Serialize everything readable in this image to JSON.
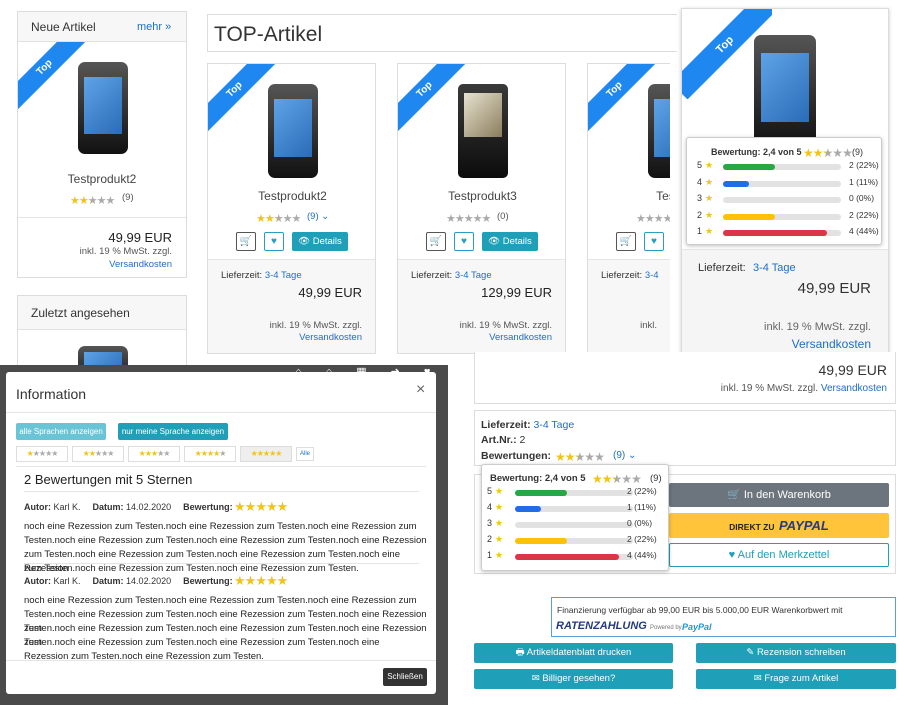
{
  "sidebar": {
    "new_title": "Neue Artikel",
    "more_link": "mehr »",
    "new_product": {
      "name": "Testprodukt2",
      "count": "(9)",
      "price": "49,99 EUR",
      "tax": "inkl. 19 % MwSt. zzgl.",
      "shipping": "Versandkosten",
      "rating": 2.4
    },
    "recent_title": "Zuletzt angesehen"
  },
  "top": {
    "title": "TOP-Artikel",
    "ribbon": "Top",
    "products": [
      {
        "name": "Testprodukt2",
        "count": "(9)",
        "delivery_label": "Lieferzeit:",
        "delivery": "3-4 Tage",
        "price": "49,99 EUR",
        "tax": "inkl. 19 % MwSt. zzgl.",
        "shipping": "Versandkosten",
        "details": "Details",
        "rating": 2.4,
        "phone": "iphone"
      },
      {
        "name": "Testprodukt3",
        "count": "(0)",
        "delivery_label": "Lieferzeit:",
        "delivery": "3-4 Tage",
        "price": "129,99 EUR",
        "tax": "inkl. 19 % MwSt. zzgl.",
        "shipping": "Versandkosten",
        "details": "Details",
        "rating": 0,
        "phone": "nokia"
      },
      {
        "name": "Testpr",
        "count": "",
        "delivery_label": "Lieferzeit:",
        "delivery": "3-4",
        "price": "",
        "tax": "inkl.",
        "shipping": "",
        "details": "",
        "rating": 0,
        "phone": "iphone"
      }
    ]
  },
  "popup_card": {
    "ribbon": "Top",
    "rating_title": "Bewertung: 2,4 von 5",
    "rating_count": "(9)",
    "delivery_label": "Lieferzeit:",
    "delivery": "3-4 Tage",
    "price": "49,99 EUR",
    "tax": "inkl. 19 % MwSt. zzgl.",
    "shipping": "Versandkosten",
    "rating": 2.4
  },
  "distribution": [
    {
      "stars": "5",
      "label": "2 (22%)",
      "fraction": 0.22,
      "color": "#28a745"
    },
    {
      "stars": "4",
      "label": "1 (11%)",
      "fraction": 0.11,
      "color": "#1e6ee8"
    },
    {
      "stars": "3",
      "label": "0 (0%)",
      "fraction": 0,
      "color": "#17a2b8"
    },
    {
      "stars": "2",
      "label": "2 (22%)",
      "fraction": 0.22,
      "color": "#ffc107"
    },
    {
      "stars": "1",
      "label": "4 (44%)",
      "fraction": 0.44,
      "color": "#dc3545"
    }
  ],
  "detail": {
    "price": "49,99 EUR",
    "tax": "inkl. 19 % MwSt. zzgl.",
    "shipping": "Versandkosten",
    "delivery_label": "Lieferzeit:",
    "delivery": "3-4 Tage",
    "artnr_label": "Art.Nr.:",
    "artnr": "2",
    "ratings_label": "Bewertungen:",
    "ratings_count": "(9)",
    "rating_title": "Bewertung: 2,4 von 5",
    "rating_count": "(9)",
    "cart_button": "In den Warenkorb",
    "paypal_prefix": "DIREKT ZU",
    "paypal_brand": "PAYPAL",
    "wishlist_button": "Auf den Merkzettel",
    "financing_text": "Finanzierung verfügbar ab 99,00 EUR bis 5.000,00 EUR Warenkorbwert mit",
    "ratenzahlung": "RATENZAHLUNG",
    "powered": "Powered by",
    "paypal_small": "PayPal",
    "datasheet_button": "Artikeldatenblatt drucken",
    "review_button": "Rezension schreiben",
    "cheaper_button": "Billiger gesehen?",
    "question_button": "Frage zum Artikel"
  },
  "modal": {
    "title": "Information",
    "close": "×",
    "btn_all_lang": "alle Sprachen anzeigen",
    "btn_my_lang": "nur meine Sprache anzeigen",
    "filter_all": "Alle",
    "heading": "2 Bewertungen mit 5 Sternen",
    "reviews": [
      {
        "author_label": "Autor:",
        "author": "Karl K.",
        "date_label": "Datum:",
        "date": "14.02.2020",
        "rating_label": "Bewertung:",
        "lines": [
          "noch eine Rezession zum Testen.noch eine Rezession zum Testen.noch eine Rezession zum",
          "Testen.noch eine Rezession zum Testen.noch eine Rezession zum Testen.noch eine Rezession",
          "zum Testen.noch eine Rezession zum Testen.noch eine Rezession zum Testen.noch eine Rezession",
          "zum Testen.noch eine Rezession zum Testen.noch eine Rezession zum Testen."
        ]
      },
      {
        "author_label": "Autor:",
        "author": "Karl K.",
        "date_label": "Datum:",
        "date": "14.02.2020",
        "rating_label": "Bewertung:",
        "lines": [
          "noch eine Rezession zum Testen.noch eine Rezession zum Testen.noch eine Rezession zum",
          "Testen.noch eine Rezession zum Testen.noch eine Rezession zum Testen.noch eine Rezession zum",
          "Testen.noch eine Rezession zum Testen.noch eine Rezession zum Testen.noch eine Rezession zum",
          "Testen.noch eine Rezession zum Testen.noch eine Rezession zum Testen.noch eine",
          "Rezession zum Testen.noch eine Rezession zum Testen."
        ]
      }
    ],
    "close_button": "Schließen"
  }
}
